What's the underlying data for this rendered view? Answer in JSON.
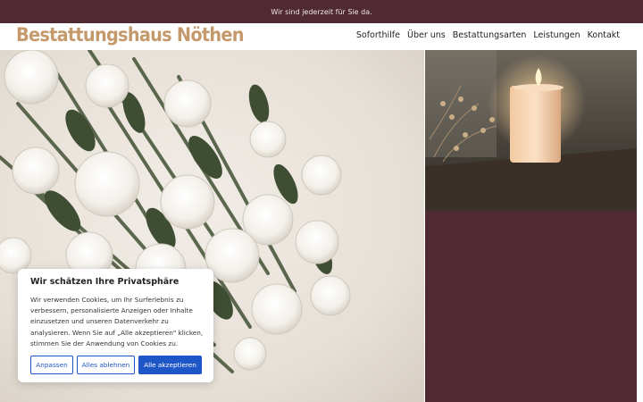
{
  "topbar": {
    "text": "Wir sind jederzeit für Sie da."
  },
  "header": {
    "logo": "Bestattungshaus Nöthen",
    "nav": [
      "Soforthilfe",
      "Über uns",
      "Bestattungsarten",
      "Leistungen",
      "Kontakt"
    ]
  },
  "cookie": {
    "title": "Wir schätzen Ihre Privatsphäre",
    "body": "Wir verwenden Cookies, um Ihr Surferlebnis zu verbessern, personalisierte Anzeigen oder Inhalte einzusetzen und unseren Datenverkehr zu analysieren. Wenn Sie auf „Alle akzeptieren\" klicken, stimmen Sie der Anwendung von Cookies zu.",
    "buttons": {
      "customize": "Anpassen",
      "reject": "Alles ablehnen",
      "accept": "Alle akzeptieren"
    }
  },
  "colors": {
    "maroon": "#4f2a32",
    "logo": "#c49a6c",
    "button_blue": "#1f56c7"
  }
}
